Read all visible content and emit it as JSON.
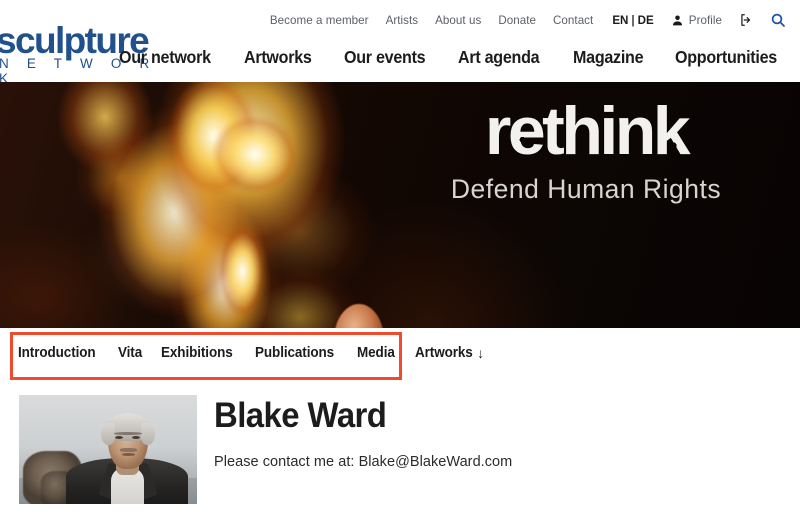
{
  "site": {
    "logo_word": "sculpture",
    "logo_sub": "N E T W O R K"
  },
  "topnav": {
    "items": [
      {
        "label": "Become a member"
      },
      {
        "label": "Artists"
      },
      {
        "label": "About us"
      },
      {
        "label": "Donate"
      },
      {
        "label": "Contact"
      }
    ],
    "lang": {
      "active": "EN",
      "separator": "|",
      "other": "DE"
    },
    "profile_label": "Profile",
    "icons": {
      "profile": "person-icon",
      "logout": "logout-icon",
      "search": "search-icon"
    }
  },
  "mainnav": {
    "items": [
      {
        "label": "Our network"
      },
      {
        "label": "Artworks"
      },
      {
        "label": "Our events"
      },
      {
        "label": "Art agenda"
      },
      {
        "label": "Magazine"
      },
      {
        "label": "Opportunities"
      }
    ]
  },
  "hero": {
    "title": "rethink",
    "subtitle": "Defend Human Rights",
    "alt": "flames with glowing sculpted head"
  },
  "tabs": {
    "items": [
      {
        "label": "Introduction"
      },
      {
        "label": "Vita"
      },
      {
        "label": "Exhibitions"
      },
      {
        "label": "Publications"
      },
      {
        "label": "Media"
      },
      {
        "label": "Artworks",
        "arrow": "↓"
      }
    ],
    "highlight_color": "#ef4a2b"
  },
  "artist": {
    "name": "Blake Ward",
    "contact": "Please contact me at: Blake@BlakeWard.com",
    "portrait_alt": "portrait of artist holding bronze sculpture"
  },
  "colors": {
    "logo_blue": "#21518C",
    "search_blue": "#1a54a8",
    "highlight_red": "#ef4a2b",
    "text_dark": "#1c1c1c",
    "text_muted": "#5b6068"
  }
}
